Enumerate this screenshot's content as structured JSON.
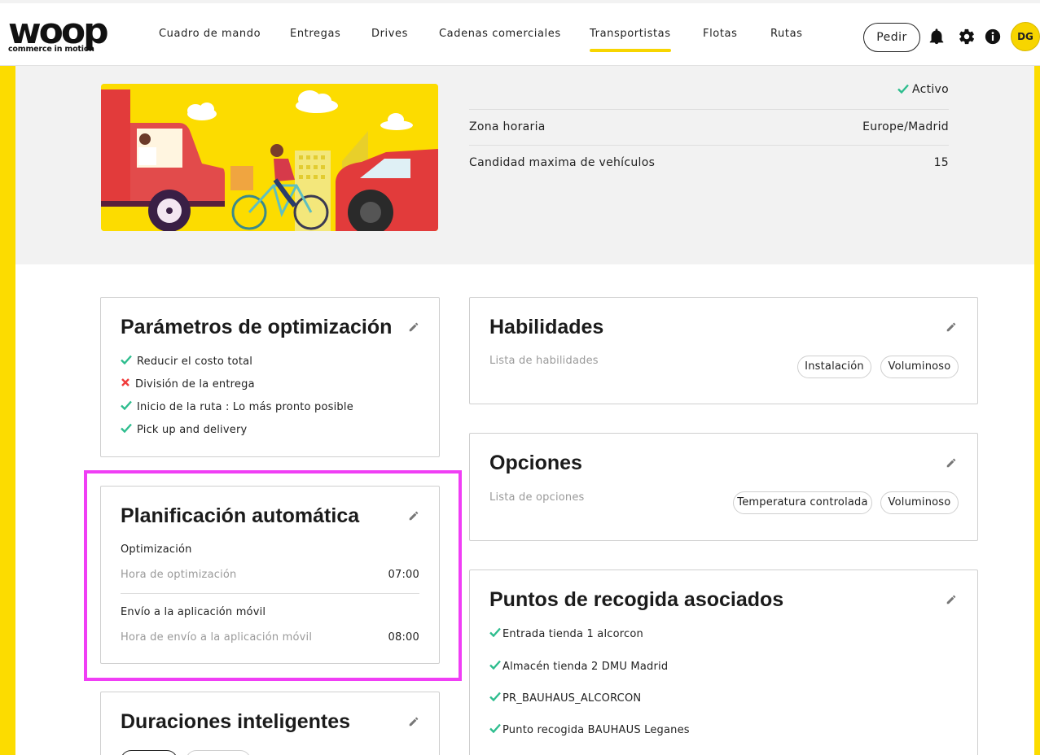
{
  "brand": {
    "name": "woop",
    "tagline": "commerce in motion"
  },
  "nav": {
    "items": [
      {
        "label": "Cuadro de mando"
      },
      {
        "label": "Entregas"
      },
      {
        "label": "Drives"
      },
      {
        "label": "Cadenas comerciales"
      },
      {
        "label": "Transportistas",
        "active": true
      },
      {
        "label": "Flotas"
      },
      {
        "label": "Rutas"
      }
    ],
    "order_button": "Pedir",
    "avatar_initials": "DG",
    "icons": [
      "bell-icon",
      "gear-icon",
      "info-icon"
    ]
  },
  "colors": {
    "accent": "#fcdc00",
    "check": "#2ebd8e",
    "cross": "#f03c3c",
    "highlight": "#f03ef5"
  },
  "carrier_info": {
    "status": "Activo",
    "timezone_label": "Zona horaria",
    "timezone_value": "Europe/Madrid",
    "max_vehicles_label": "Candidad maxima de vehículos",
    "max_vehicles_value": "15"
  },
  "optimization": {
    "title": "Parámetros de optimización",
    "items": [
      {
        "label": "Reducir el costo total",
        "enabled": true
      },
      {
        "label": "División de la entrega",
        "enabled": false
      },
      {
        "label": "Inicio de la ruta : Lo más pronto posible",
        "enabled": true
      },
      {
        "label": "Pick up and delivery",
        "enabled": true
      }
    ]
  },
  "auto_planning": {
    "title": "Planificación automática",
    "optimization_heading": "Optimización",
    "optimization_time_label": "Hora de optimización",
    "optimization_time": "07:00",
    "mobile_heading": "Envío a la aplicación móvil",
    "mobile_time_label": "Hora de envío a la aplicación móvil",
    "mobile_time": "08:00"
  },
  "smart_durations": {
    "title": "Duraciones inteligentes"
  },
  "skills": {
    "title": "Habilidades",
    "list_label": "Lista de habilidades",
    "tags": [
      "Instalación",
      "Voluminoso"
    ]
  },
  "options": {
    "title": "Opciones",
    "list_label": "Lista de opciones",
    "tags": [
      "Temperatura controlada",
      "Voluminoso"
    ]
  },
  "pickup_points": {
    "title": "Puntos de recogida asociados",
    "items": [
      "Entrada tienda 1 alcorcon",
      "Almacén tienda 2 DMU Madrid",
      "PR_BAUHAUS_ALCORCON",
      "Punto recogida BAUHAUS Leganes"
    ]
  }
}
